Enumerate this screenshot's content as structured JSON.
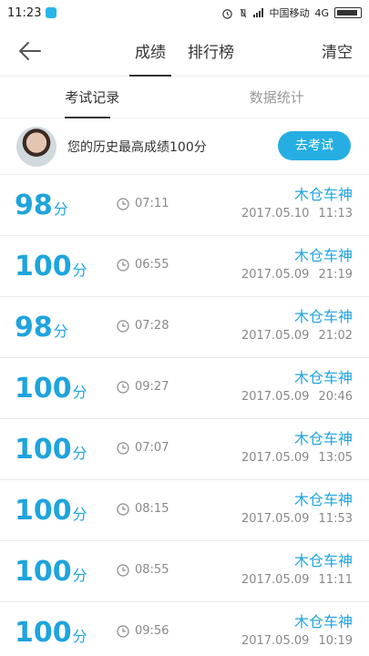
{
  "status_bar": {
    "time": "11:23",
    "carrier": "中国移动",
    "network": "4G"
  },
  "nav": {
    "tabs": [
      {
        "label": "成绩"
      },
      {
        "label": "排行榜"
      }
    ],
    "clear_label": "清空"
  },
  "sub_tabs": [
    {
      "label": "考试记录"
    },
    {
      "label": "数据统计"
    }
  ],
  "best": {
    "text": "您的历史最高成绩100分",
    "button_label": "去考试"
  },
  "score_unit": "分",
  "records": [
    {
      "score": "98",
      "duration": "07:11",
      "name": "木仓车神",
      "date": "2017.05.10",
      "time": "11:13"
    },
    {
      "score": "100",
      "duration": "06:55",
      "name": "木仓车神",
      "date": "2017.05.09",
      "time": "21:19"
    },
    {
      "score": "98",
      "duration": "07:28",
      "name": "木仓车神",
      "date": "2017.05.09",
      "time": "21:02"
    },
    {
      "score": "100",
      "duration": "09:27",
      "name": "木仓车神",
      "date": "2017.05.09",
      "time": "20:46"
    },
    {
      "score": "100",
      "duration": "07:07",
      "name": "木仓车神",
      "date": "2017.05.09",
      "time": "13:05"
    },
    {
      "score": "100",
      "duration": "08:15",
      "name": "木仓车神",
      "date": "2017.05.09",
      "time": "11:53"
    },
    {
      "score": "100",
      "duration": "08:55",
      "name": "木仓车神",
      "date": "2017.05.09",
      "time": "11:11"
    },
    {
      "score": "100",
      "duration": "09:56",
      "name": "木仓车神",
      "date": "2017.05.09",
      "time": "10:19"
    }
  ],
  "colors": {
    "accent": "#1ea4dd",
    "button": "#26aee3"
  }
}
